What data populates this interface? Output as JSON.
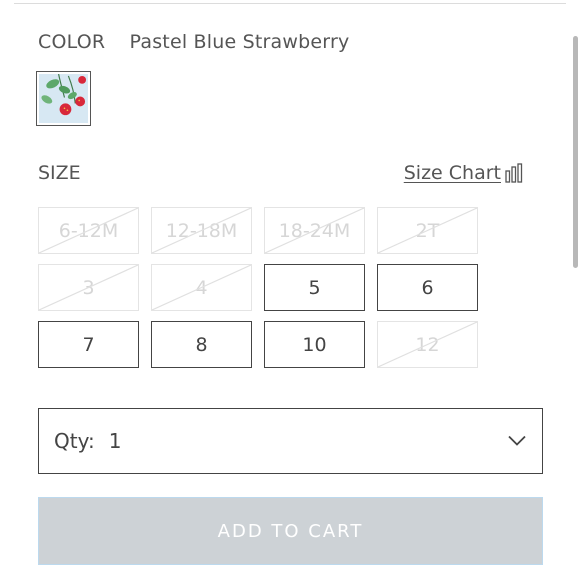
{
  "color": {
    "label": "COLOR",
    "selected": "Pastel Blue Strawberry",
    "swatch_icon": "strawberry-pattern-swatch"
  },
  "size": {
    "label": "SIZE",
    "chart_link": "Size Chart",
    "chart_icon": "ruler-icon",
    "options": [
      {
        "label": "6-12M",
        "available": false
      },
      {
        "label": "12-18M",
        "available": false
      },
      {
        "label": "18-24M",
        "available": false
      },
      {
        "label": "2T",
        "available": false
      },
      {
        "label": "3",
        "available": false
      },
      {
        "label": "4",
        "available": false
      },
      {
        "label": "5",
        "available": true
      },
      {
        "label": "6",
        "available": true
      },
      {
        "label": "7",
        "available": true
      },
      {
        "label": "8",
        "available": true
      },
      {
        "label": "10",
        "available": true
      },
      {
        "label": "12",
        "available": false
      }
    ]
  },
  "quantity": {
    "label": "Qty:",
    "value": "1"
  },
  "cart": {
    "add_label": "ADD TO CART"
  },
  "colors": {
    "text": "#4a4a4a",
    "disabled_border": "#e4e4e4",
    "button_bg": "#cdd2d6",
    "button_border": "#bcd9ee"
  }
}
